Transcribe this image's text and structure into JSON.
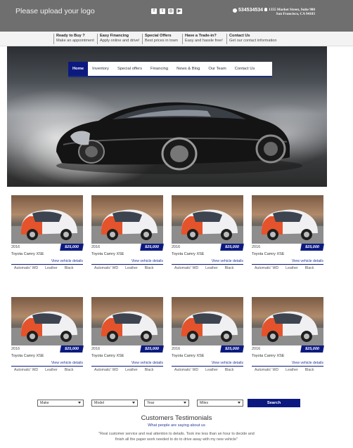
{
  "header": {
    "logo_text": "Please upload your logo",
    "social_icons": [
      "facebook-icon",
      "twitter-icon",
      "instagram-icon",
      "youtube-icon"
    ],
    "phone": "534534534",
    "address": "1355 Market Street, Suite 900 San Francisco, CA 94103"
  },
  "infobar": [
    {
      "title": "Ready to Buy ?",
      "text": "Make an appointment"
    },
    {
      "title": "Easy Financing",
      "text": "Apply online and drive!"
    },
    {
      "title": "Special Offers",
      "text": "Best prices in town"
    },
    {
      "title": "Have a Trade-in?",
      "text": "Easy and hassle free!"
    },
    {
      "title": "Contact Us",
      "text": "Get our contact information"
    }
  ],
  "nav": [
    "Home",
    "Inventory",
    "Special offers",
    "Financing",
    "News & Blog",
    "Our Team",
    "Contact Us"
  ],
  "listings": [
    {
      "year": "2016",
      "price": "$25,000",
      "model": "Toyota Camry XSE",
      "link": "View vehicle details",
      "trans": "Automatic' WD",
      "interior": "Leather",
      "color": "Black"
    },
    {
      "year": "2016",
      "price": "$25,000",
      "model": "Toyota Camry XSE",
      "link": "View vehicle details",
      "trans": "Automatic' WD",
      "interior": "Leather",
      "color": "Black"
    },
    {
      "year": "2016",
      "price": "$25,000",
      "model": "Toyota Camry XSE",
      "link": "View vehicle details",
      "trans": "Automatic' WD",
      "interior": "Leather",
      "color": "Black"
    },
    {
      "year": "2016",
      "price": "$25,000",
      "model": "Toyota Camry XSE",
      "link": "View vehicle details",
      "trans": "Automatic' WD",
      "interior": "Leather",
      "color": "Black"
    },
    {
      "year": "2016",
      "price": "$25,000",
      "model": "Toyota Camry XSE",
      "link": "View vehicle details",
      "trans": "Automatic' WD",
      "interior": "Leather",
      "color": "Black"
    },
    {
      "year": "2016",
      "price": "$25,000",
      "model": "Toyota Camry XSE",
      "link": "View vehicle details",
      "trans": "Automatic' WD",
      "interior": "Leather",
      "color": "Black"
    },
    {
      "year": "2016",
      "price": "$25,000",
      "model": "Toyota Camry XSE",
      "link": "View vehicle details",
      "trans": "Automatic' WD",
      "interior": "Leather",
      "color": "Black"
    },
    {
      "year": "2016",
      "price": "$25,000",
      "model": "Toyota Camry XSE",
      "link": "View vehicle details",
      "trans": "Automatic' WD",
      "interior": "Leather",
      "color": "Black"
    }
  ],
  "search": {
    "make": "Make",
    "model": "Model",
    "year": "Year",
    "miles": "Miles",
    "button": "Search"
  },
  "testimonials": {
    "title": "Customers Testimonials",
    "subtitle": "What people are saying about us",
    "quote": "\"Real customer service and real attention to details. Took me less than an hour to decide and finish all the paper work needed to do to drive away with my new vehicle\""
  },
  "colors": {
    "accent": "#0c1a80",
    "topbar": "#6f6f6f",
    "infobar": "#f3f3f3"
  }
}
